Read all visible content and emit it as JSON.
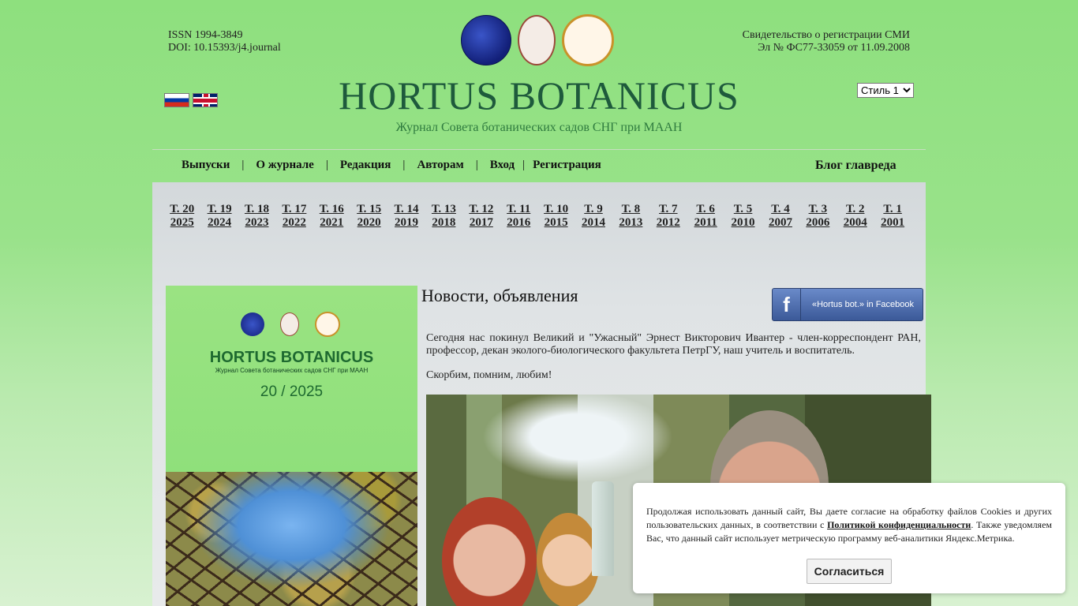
{
  "header": {
    "issn": "ISSN 1994-3849",
    "doi": "DOI: 10.15393/j4.journal",
    "reg_line1": "Свидетельство о регистрации СМИ",
    "reg_line2": "Эл № ФС77-33059 от 11.09.2008",
    "title": "HORTUS BOTANICUS",
    "subtitle": "Журнал Совета ботанических садов СНГ при МААН",
    "style_select": "Стиль 1"
  },
  "nav": {
    "issues": "Выпуски",
    "about": "О журнале",
    "editorial": "Редакция",
    "authors": "Авторам",
    "login": "Вход",
    "register": "Регистрация",
    "blog": "Блог главреда",
    "separator": "|"
  },
  "volumes": [
    {
      "vol": "Т. 20",
      "year": "2025"
    },
    {
      "vol": "Т. 19",
      "year": "2024"
    },
    {
      "vol": "Т. 18",
      "year": "2023"
    },
    {
      "vol": "Т. 17",
      "year": "2022"
    },
    {
      "vol": "Т. 16",
      "year": "2021"
    },
    {
      "vol": "Т. 15",
      "year": "2020"
    },
    {
      "vol": "Т. 14",
      "year": "2019"
    },
    {
      "vol": "Т. 13",
      "year": "2018"
    },
    {
      "vol": "Т. 12",
      "year": "2017"
    },
    {
      "vol": "Т. 11",
      "year": "2016"
    },
    {
      "vol": "Т. 10",
      "year": "2015"
    },
    {
      "vol": "Т. 9",
      "year": "2014"
    },
    {
      "vol": "Т. 8",
      "year": "2013"
    },
    {
      "vol": "Т. 7",
      "year": "2012"
    },
    {
      "vol": "Т. 6",
      "year": "2011"
    },
    {
      "vol": "Т. 5",
      "year": "2010"
    },
    {
      "vol": "Т. 4",
      "year": "2007"
    },
    {
      "vol": "Т. 3",
      "year": "2006"
    },
    {
      "vol": "Т. 2",
      "year": "2004"
    },
    {
      "vol": "Т. 1",
      "year": "2001"
    }
  ],
  "cover": {
    "title": "HORTUS BOTANICUS",
    "subtitle": "Журнал Совета ботанических садов СНГ при МААН",
    "issue": "20 / 2025"
  },
  "news": {
    "heading": "Новости, объявления",
    "facebook_label": "«Hortus bot.» in Facebook",
    "facebook_letter": "f",
    "paragraph1": "Сегодня нас покинул Великий и \"Ужасный\" Эрнест Викторович Ивантер - член-корреспондент РАН, профессор, декан эколого-биологического факультета ПетрГУ, наш учитель и воспитатель.",
    "paragraph2": "Скорбим, помним, любим!"
  },
  "cookie": {
    "text_before": "Продолжая использовать данный сайт, Вы даете согласие на обработку файлов Cookies и других пользовательских данных, в соответствии с ",
    "link": "Политикой конфиденциальности",
    "text_after": ". Также уведомляем Вас, что данный сайт использует метрическую программу веб-аналитики Яндекс.Метрика.",
    "button": "Согласиться"
  }
}
